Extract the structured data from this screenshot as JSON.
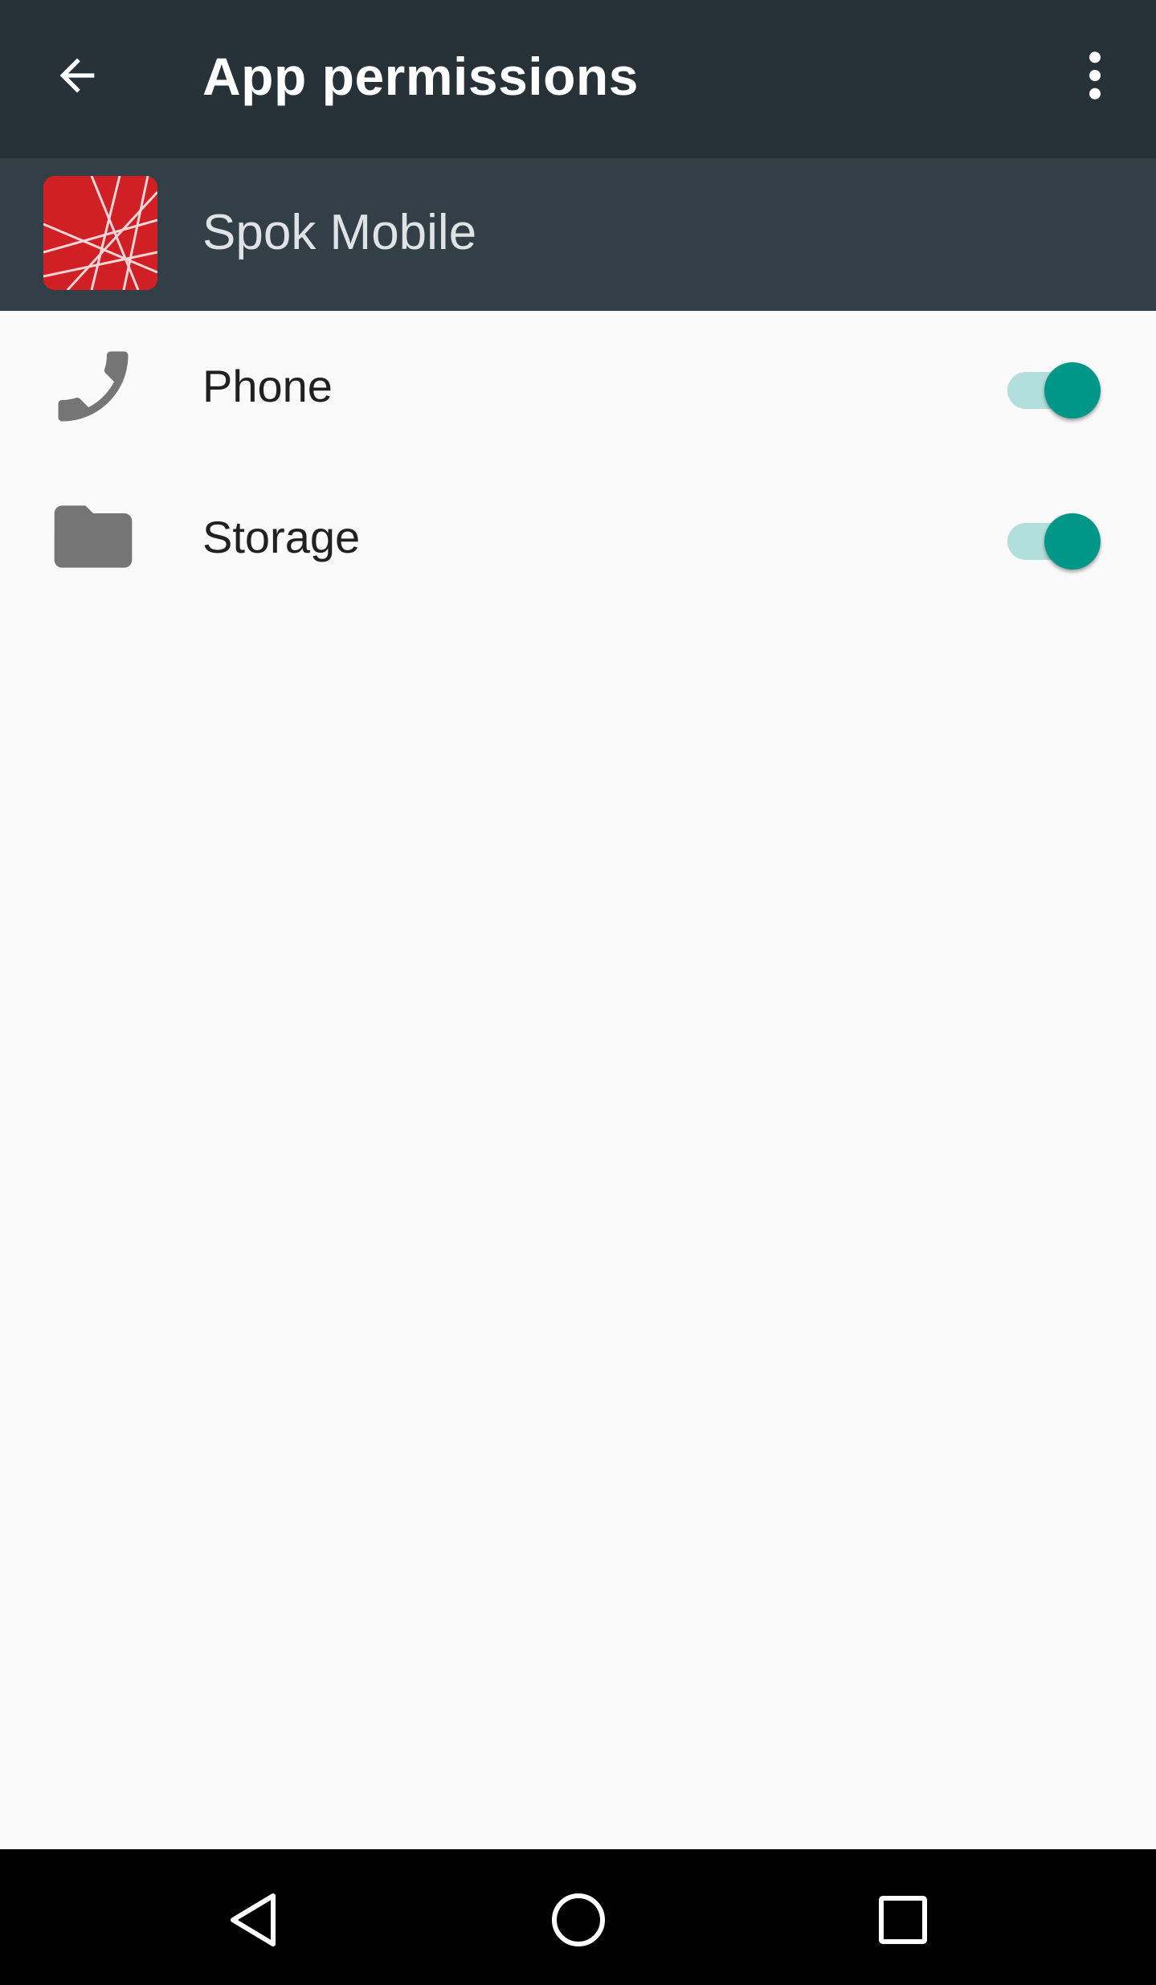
{
  "appbar": {
    "title": "App permissions",
    "back_icon": "arrow-back-icon",
    "overflow_icon": "more-vert-icon"
  },
  "app": {
    "name": "Spok Mobile",
    "icon": "spok-mobile-app-icon",
    "icon_color": "#d11f26"
  },
  "permissions": [
    {
      "label": "Phone",
      "icon": "phone-icon",
      "enabled": true
    },
    {
      "label": "Storage",
      "icon": "folder-icon",
      "enabled": true
    }
  ],
  "navbar": {
    "buttons": [
      "back-triangle-icon",
      "home-circle-icon",
      "recents-square-icon"
    ]
  },
  "colors": {
    "toolbar": "#263238",
    "app_header": "#323f47",
    "accent": "#009688",
    "accent_track": "#b2dfdb",
    "background": "#fafafa"
  }
}
